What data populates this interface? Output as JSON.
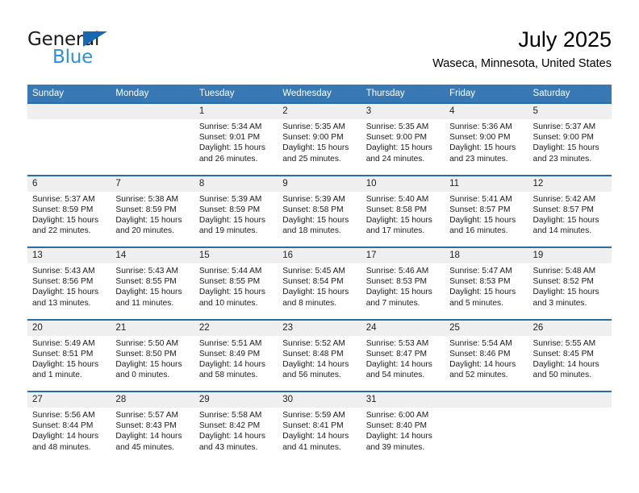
{
  "brand": {
    "name_part1": "General",
    "name_part2": "Blue",
    "accent_color": "#1668b3",
    "light_accent_color": "#2b8fdd"
  },
  "header": {
    "title": "July 2025",
    "location": "Waseca, Minnesota, United States"
  },
  "calendar": {
    "header_bg": "#3778b5",
    "row_border": "#2b6ca8",
    "daynum_bg": "#efefef",
    "weekdays": [
      "Sunday",
      "Monday",
      "Tuesday",
      "Wednesday",
      "Thursday",
      "Friday",
      "Saturday"
    ],
    "weeks": [
      [
        {
          "day": "",
          "empty": true
        },
        {
          "day": "",
          "empty": true
        },
        {
          "day": "1",
          "sunrise": "Sunrise: 5:34 AM",
          "sunset": "Sunset: 9:01 PM",
          "daylight_line1": "Daylight: 15 hours",
          "daylight_line2": "and 26 minutes."
        },
        {
          "day": "2",
          "sunrise": "Sunrise: 5:35 AM",
          "sunset": "Sunset: 9:00 PM",
          "daylight_line1": "Daylight: 15 hours",
          "daylight_line2": "and 25 minutes."
        },
        {
          "day": "3",
          "sunrise": "Sunrise: 5:35 AM",
          "sunset": "Sunset: 9:00 PM",
          "daylight_line1": "Daylight: 15 hours",
          "daylight_line2": "and 24 minutes."
        },
        {
          "day": "4",
          "sunrise": "Sunrise: 5:36 AM",
          "sunset": "Sunset: 9:00 PM",
          "daylight_line1": "Daylight: 15 hours",
          "daylight_line2": "and 23 minutes."
        },
        {
          "day": "5",
          "sunrise": "Sunrise: 5:37 AM",
          "sunset": "Sunset: 9:00 PM",
          "daylight_line1": "Daylight: 15 hours",
          "daylight_line2": "and 23 minutes."
        }
      ],
      [
        {
          "day": "6",
          "sunrise": "Sunrise: 5:37 AM",
          "sunset": "Sunset: 8:59 PM",
          "daylight_line1": "Daylight: 15 hours",
          "daylight_line2": "and 22 minutes."
        },
        {
          "day": "7",
          "sunrise": "Sunrise: 5:38 AM",
          "sunset": "Sunset: 8:59 PM",
          "daylight_line1": "Daylight: 15 hours",
          "daylight_line2": "and 20 minutes."
        },
        {
          "day": "8",
          "sunrise": "Sunrise: 5:39 AM",
          "sunset": "Sunset: 8:59 PM",
          "daylight_line1": "Daylight: 15 hours",
          "daylight_line2": "and 19 minutes."
        },
        {
          "day": "9",
          "sunrise": "Sunrise: 5:39 AM",
          "sunset": "Sunset: 8:58 PM",
          "daylight_line1": "Daylight: 15 hours",
          "daylight_line2": "and 18 minutes."
        },
        {
          "day": "10",
          "sunrise": "Sunrise: 5:40 AM",
          "sunset": "Sunset: 8:58 PM",
          "daylight_line1": "Daylight: 15 hours",
          "daylight_line2": "and 17 minutes."
        },
        {
          "day": "11",
          "sunrise": "Sunrise: 5:41 AM",
          "sunset": "Sunset: 8:57 PM",
          "daylight_line1": "Daylight: 15 hours",
          "daylight_line2": "and 16 minutes."
        },
        {
          "day": "12",
          "sunrise": "Sunrise: 5:42 AM",
          "sunset": "Sunset: 8:57 PM",
          "daylight_line1": "Daylight: 15 hours",
          "daylight_line2": "and 14 minutes."
        }
      ],
      [
        {
          "day": "13",
          "sunrise": "Sunrise: 5:43 AM",
          "sunset": "Sunset: 8:56 PM",
          "daylight_line1": "Daylight: 15 hours",
          "daylight_line2": "and 13 minutes."
        },
        {
          "day": "14",
          "sunrise": "Sunrise: 5:43 AM",
          "sunset": "Sunset: 8:55 PM",
          "daylight_line1": "Daylight: 15 hours",
          "daylight_line2": "and 11 minutes."
        },
        {
          "day": "15",
          "sunrise": "Sunrise: 5:44 AM",
          "sunset": "Sunset: 8:55 PM",
          "daylight_line1": "Daylight: 15 hours",
          "daylight_line2": "and 10 minutes."
        },
        {
          "day": "16",
          "sunrise": "Sunrise: 5:45 AM",
          "sunset": "Sunset: 8:54 PM",
          "daylight_line1": "Daylight: 15 hours",
          "daylight_line2": "and 8 minutes."
        },
        {
          "day": "17",
          "sunrise": "Sunrise: 5:46 AM",
          "sunset": "Sunset: 8:53 PM",
          "daylight_line1": "Daylight: 15 hours",
          "daylight_line2": "and 7 minutes."
        },
        {
          "day": "18",
          "sunrise": "Sunrise: 5:47 AM",
          "sunset": "Sunset: 8:53 PM",
          "daylight_line1": "Daylight: 15 hours",
          "daylight_line2": "and 5 minutes."
        },
        {
          "day": "19",
          "sunrise": "Sunrise: 5:48 AM",
          "sunset": "Sunset: 8:52 PM",
          "daylight_line1": "Daylight: 15 hours",
          "daylight_line2": "and 3 minutes."
        }
      ],
      [
        {
          "day": "20",
          "sunrise": "Sunrise: 5:49 AM",
          "sunset": "Sunset: 8:51 PM",
          "daylight_line1": "Daylight: 15 hours",
          "daylight_line2": "and 1 minute."
        },
        {
          "day": "21",
          "sunrise": "Sunrise: 5:50 AM",
          "sunset": "Sunset: 8:50 PM",
          "daylight_line1": "Daylight: 15 hours",
          "daylight_line2": "and 0 minutes."
        },
        {
          "day": "22",
          "sunrise": "Sunrise: 5:51 AM",
          "sunset": "Sunset: 8:49 PM",
          "daylight_line1": "Daylight: 14 hours",
          "daylight_line2": "and 58 minutes."
        },
        {
          "day": "23",
          "sunrise": "Sunrise: 5:52 AM",
          "sunset": "Sunset: 8:48 PM",
          "daylight_line1": "Daylight: 14 hours",
          "daylight_line2": "and 56 minutes."
        },
        {
          "day": "24",
          "sunrise": "Sunrise: 5:53 AM",
          "sunset": "Sunset: 8:47 PM",
          "daylight_line1": "Daylight: 14 hours",
          "daylight_line2": "and 54 minutes."
        },
        {
          "day": "25",
          "sunrise": "Sunrise: 5:54 AM",
          "sunset": "Sunset: 8:46 PM",
          "daylight_line1": "Daylight: 14 hours",
          "daylight_line2": "and 52 minutes."
        },
        {
          "day": "26",
          "sunrise": "Sunrise: 5:55 AM",
          "sunset": "Sunset: 8:45 PM",
          "daylight_line1": "Daylight: 14 hours",
          "daylight_line2": "and 50 minutes."
        }
      ],
      [
        {
          "day": "27",
          "sunrise": "Sunrise: 5:56 AM",
          "sunset": "Sunset: 8:44 PM",
          "daylight_line1": "Daylight: 14 hours",
          "daylight_line2": "and 48 minutes."
        },
        {
          "day": "28",
          "sunrise": "Sunrise: 5:57 AM",
          "sunset": "Sunset: 8:43 PM",
          "daylight_line1": "Daylight: 14 hours",
          "daylight_line2": "and 45 minutes."
        },
        {
          "day": "29",
          "sunrise": "Sunrise: 5:58 AM",
          "sunset": "Sunset: 8:42 PM",
          "daylight_line1": "Daylight: 14 hours",
          "daylight_line2": "and 43 minutes."
        },
        {
          "day": "30",
          "sunrise": "Sunrise: 5:59 AM",
          "sunset": "Sunset: 8:41 PM",
          "daylight_line1": "Daylight: 14 hours",
          "daylight_line2": "and 41 minutes."
        },
        {
          "day": "31",
          "sunrise": "Sunrise: 6:00 AM",
          "sunset": "Sunset: 8:40 PM",
          "daylight_line1": "Daylight: 14 hours",
          "daylight_line2": "and 39 minutes."
        },
        {
          "day": "",
          "empty": true
        },
        {
          "day": "",
          "empty": true
        }
      ]
    ]
  }
}
